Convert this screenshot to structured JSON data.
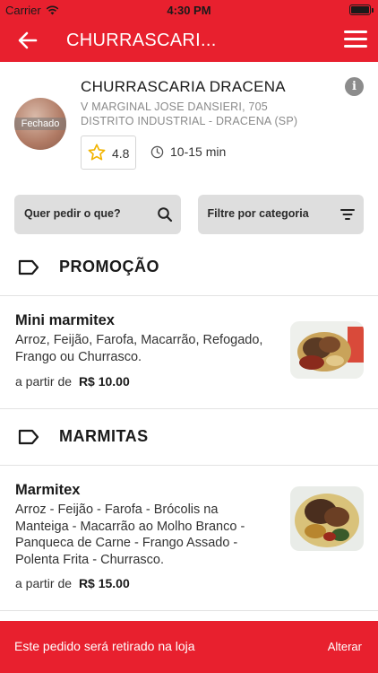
{
  "status_bar": {
    "carrier": "Carrier",
    "time": "4:30 PM"
  },
  "nav": {
    "title": "CHURRASCARI..."
  },
  "store": {
    "name": "CHURRASCARIA DRACENA",
    "address": "V MARGINAL JOSE DANSIERI, 705  DISTRITO INDUSTRIAL  - DRACENA (SP)",
    "status": "Fechado",
    "rating": "4.8",
    "delivery_time": "10-15 min"
  },
  "filters": {
    "search_label": "Quer pedir o que?",
    "category_label": "Filtre por categoria"
  },
  "sections": [
    {
      "title": "PROMOÇÃO",
      "items": [
        {
          "name": "Mini marmitex",
          "description": "Arroz, Feijão, Farofa, Macarrão, Refogado, Frango ou Churrasco.",
          "price_prefix": "a partir de",
          "price": "R$ 10.00"
        }
      ]
    },
    {
      "title": "MARMITAS",
      "items": [
        {
          "name": "Marmitex",
          "description": "Arroz - Feijão - Farofa - Brócolis na Manteiga - Macarrão ao Molho Branco -  Panqueca de Carne - Frango Assado -  Polenta Frita - Churrasco.",
          "price_prefix": "a partir de",
          "price": "R$ 15.00"
        }
      ]
    }
  ],
  "bottom_bar": {
    "message": "Este pedido será retirado na loja",
    "action": "Alterar"
  },
  "colors": {
    "brand": "#e8202e",
    "filter_bg": "#dedede"
  }
}
